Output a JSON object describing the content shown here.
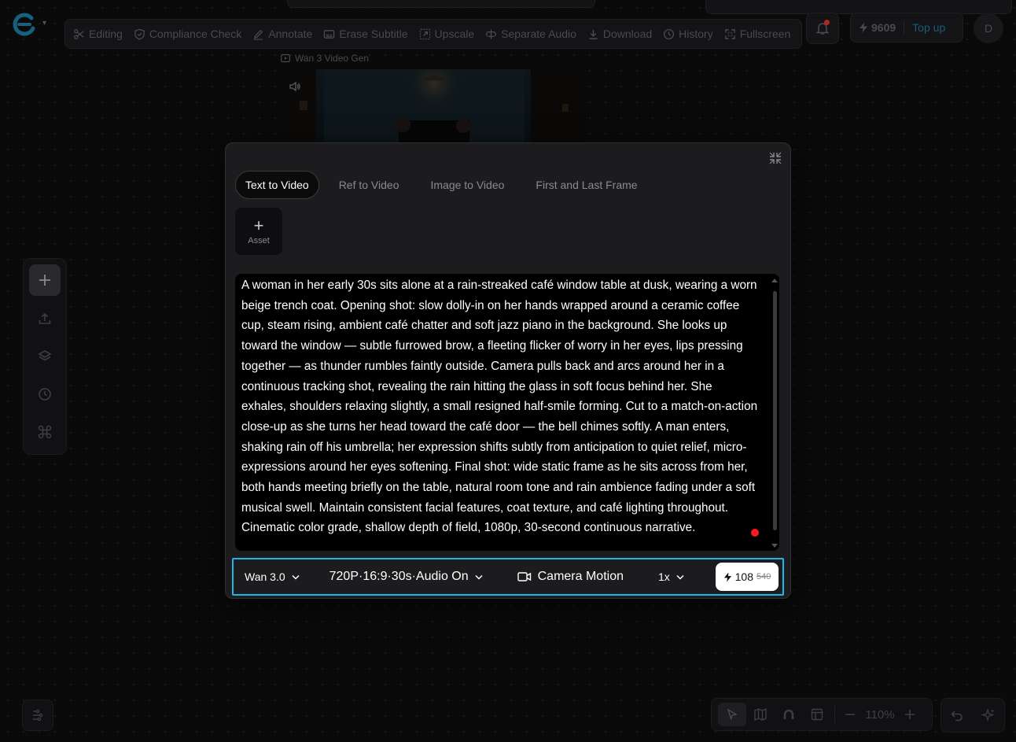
{
  "toolbar": {
    "items": [
      {
        "label": "Editing",
        "icon": "scissors-icon"
      },
      {
        "label": "Compliance Check",
        "icon": "shield-icon"
      },
      {
        "label": "Annotate",
        "icon": "pen-icon"
      },
      {
        "label": "Erase Subtitle",
        "icon": "subtitle-icon"
      },
      {
        "label": "Upscale",
        "icon": "upscale-icon"
      },
      {
        "label": "Separate Audio",
        "icon": "split-icon"
      },
      {
        "label": "Download",
        "icon": "download-icon"
      },
      {
        "label": "History",
        "icon": "clock-icon"
      },
      {
        "label": "Fullscreen",
        "icon": "fullscreen-icon"
      }
    ]
  },
  "header": {
    "credits": "9609",
    "topup_label": "Top up",
    "avatar_initial": "D"
  },
  "video_node": {
    "label": "Wan 3 Video Gen"
  },
  "dialog": {
    "tabs": [
      {
        "label": "Text to Video",
        "active": true
      },
      {
        "label": "Ref to Video",
        "active": false
      },
      {
        "label": "Image to Video",
        "active": false
      },
      {
        "label": "First and Last Frame",
        "active": false
      }
    ],
    "asset_label": "Asset",
    "prompt": "A woman in her early 30s sits alone at a rain-streaked café window table at dusk, wearing a worn beige trench coat. Opening shot: slow dolly-in on her hands wrapped around a ceramic coffee cup, steam rising, ambient café chatter and soft jazz piano in the background. She looks up toward the window — subtle furrowed brow, a fleeting flicker of worry in her eyes, lips pressing together — as thunder rumbles faintly outside. Camera pulls back and arcs around her in a continuous tracking shot, revealing the rain hitting the glass in soft focus behind her. She exhales, shoulders relaxing slightly, a small resigned half-smile forming. Cut to a match-on-action close-up as she turns her head toward the café door — the bell chimes softly. A man enters, shaking rain off his umbrella; her expression shifts subtly from anticipation to quiet relief, micro-expressions around her eyes softening. Final shot: wide static frame as he sits across from her, both hands meeting briefly on the table, natural room tone and rain ambience fading under a soft musical swell. Maintain consistent facial features, coat texture, and café lighting throughout. Cinematic color grade, shallow depth of field, 1080p, 30-second continuous narrative.",
    "settings": {
      "model": "Wan 3.0",
      "resolution": "720P·16:9·30s·Audio On",
      "camera_motion": "Camera Motion",
      "speed": "1x",
      "cost": "108",
      "original_cost": "540"
    }
  },
  "zoom": {
    "level": "110%"
  },
  "colors": {
    "accent": "#1fb6ea",
    "logo": "#1fa7d6",
    "record": "#ff1a1a"
  }
}
